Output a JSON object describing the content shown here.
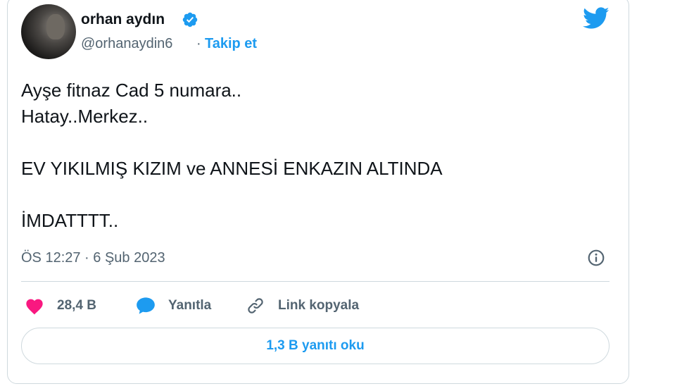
{
  "author": {
    "display_name": "orhan aydın",
    "handle": "@orhanaydin6",
    "separator": "·",
    "follow_label": "Takip et"
  },
  "tweet": {
    "lines": [
      "Ayşe fitnaz Cad 5 numara..",
      "Hatay..Merkez..",
      "",
      "EV YIKILMIŞ KIZIM ve ANNESİ ENKAZIN ALTINDA",
      "",
      "İMDATTTT.."
    ],
    "timestamp": "ÖS 12:27 · 6 Şub 2023"
  },
  "actions": {
    "like_count": "28,4 B",
    "reply_label": "Yanıtla",
    "copy_link_label": "Link kopyala",
    "read_replies_label": "1,3 B yanıtı oku"
  },
  "icons": {
    "verified": "verified-badge-icon",
    "twitter": "twitter-bird-icon",
    "info": "info-icon",
    "like": "heart-icon",
    "reply": "speech-bubble-icon",
    "link": "link-icon"
  },
  "colors": {
    "accent": "#1d9bf0",
    "like": "#f91880",
    "text": "#0f1419",
    "muted": "#536471",
    "border": "#cfd9de"
  }
}
